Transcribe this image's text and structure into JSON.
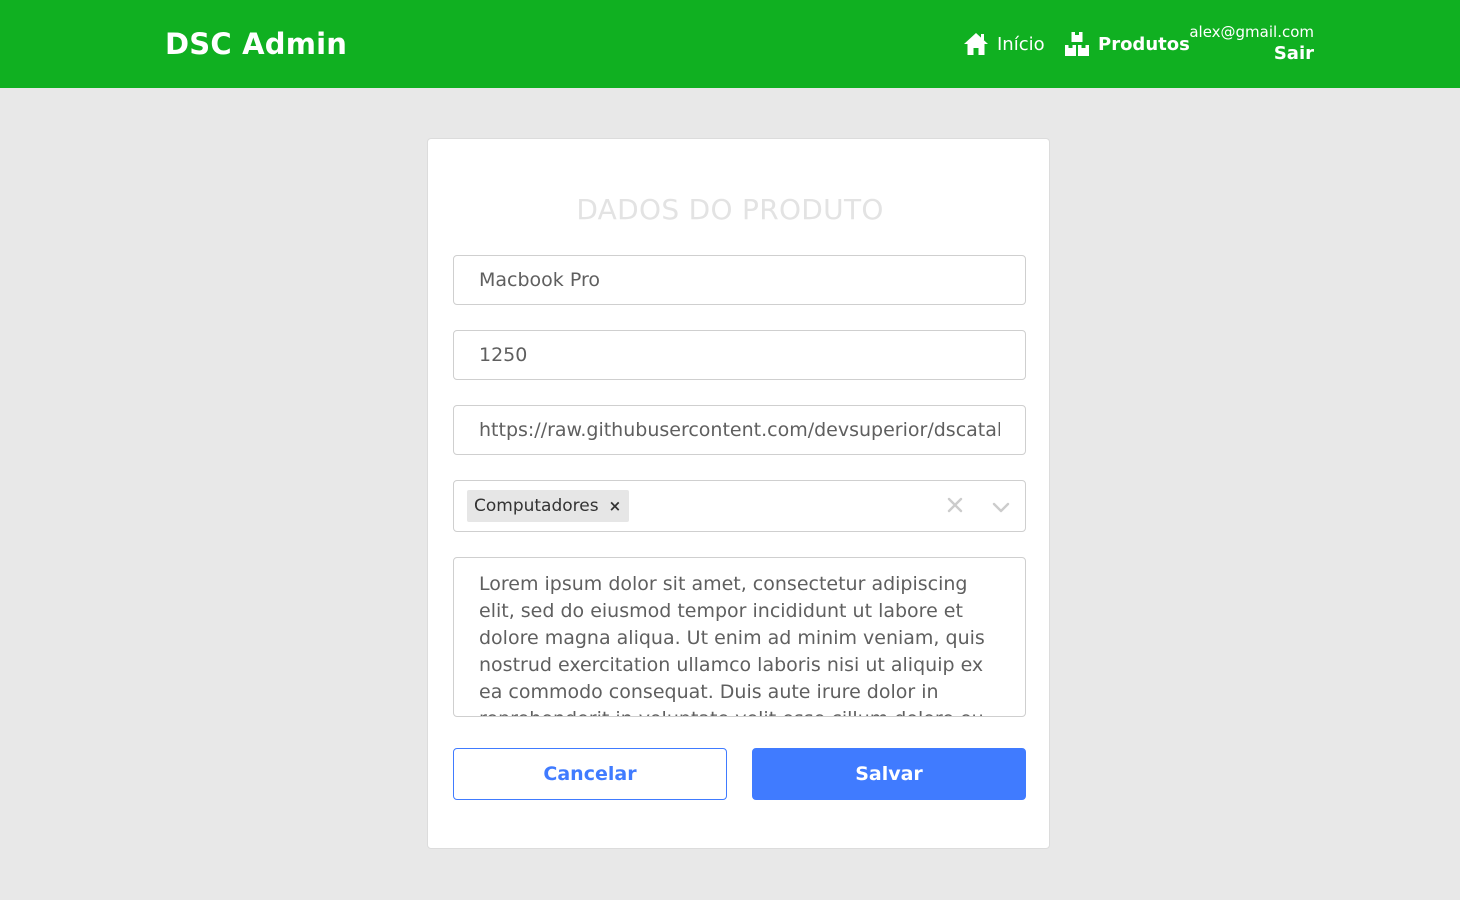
{
  "navbar": {
    "brand": "DSC Admin",
    "links": [
      {
        "label": "Início",
        "icon": "home-icon"
      },
      {
        "label": "Produtos",
        "icon": "products-icon"
      }
    ],
    "user_email": "alex@gmail.com",
    "logout_label": "Sair",
    "bg_color": "#10b021"
  },
  "form": {
    "title": "DADOS DO PRODUTO",
    "name_value": "Macbook Pro",
    "price_value": "1250",
    "img_url_value": "https://raw.githubusercontent.com/devsuperior/dscatalog",
    "categories": [
      {
        "label": "Computadores",
        "remove_glyph": "×"
      }
    ],
    "description_value": "Lorem ipsum dolor sit amet, consectetur adipiscing elit, sed do eiusmod tempor incididunt ut labore et dolore magna aliqua. Ut enim ad minim veniam, quis nostrud exercitation ullamco laboris nisi ut aliquip ex ea commodo consequat. Duis aute irure dolor in reprehenderit in voluptate velit esse cillum dolore eu fugiat nulla pariatur.",
    "cancel_label": "Cancelar",
    "save_label": "Salvar",
    "accent_color": "#407bff"
  }
}
